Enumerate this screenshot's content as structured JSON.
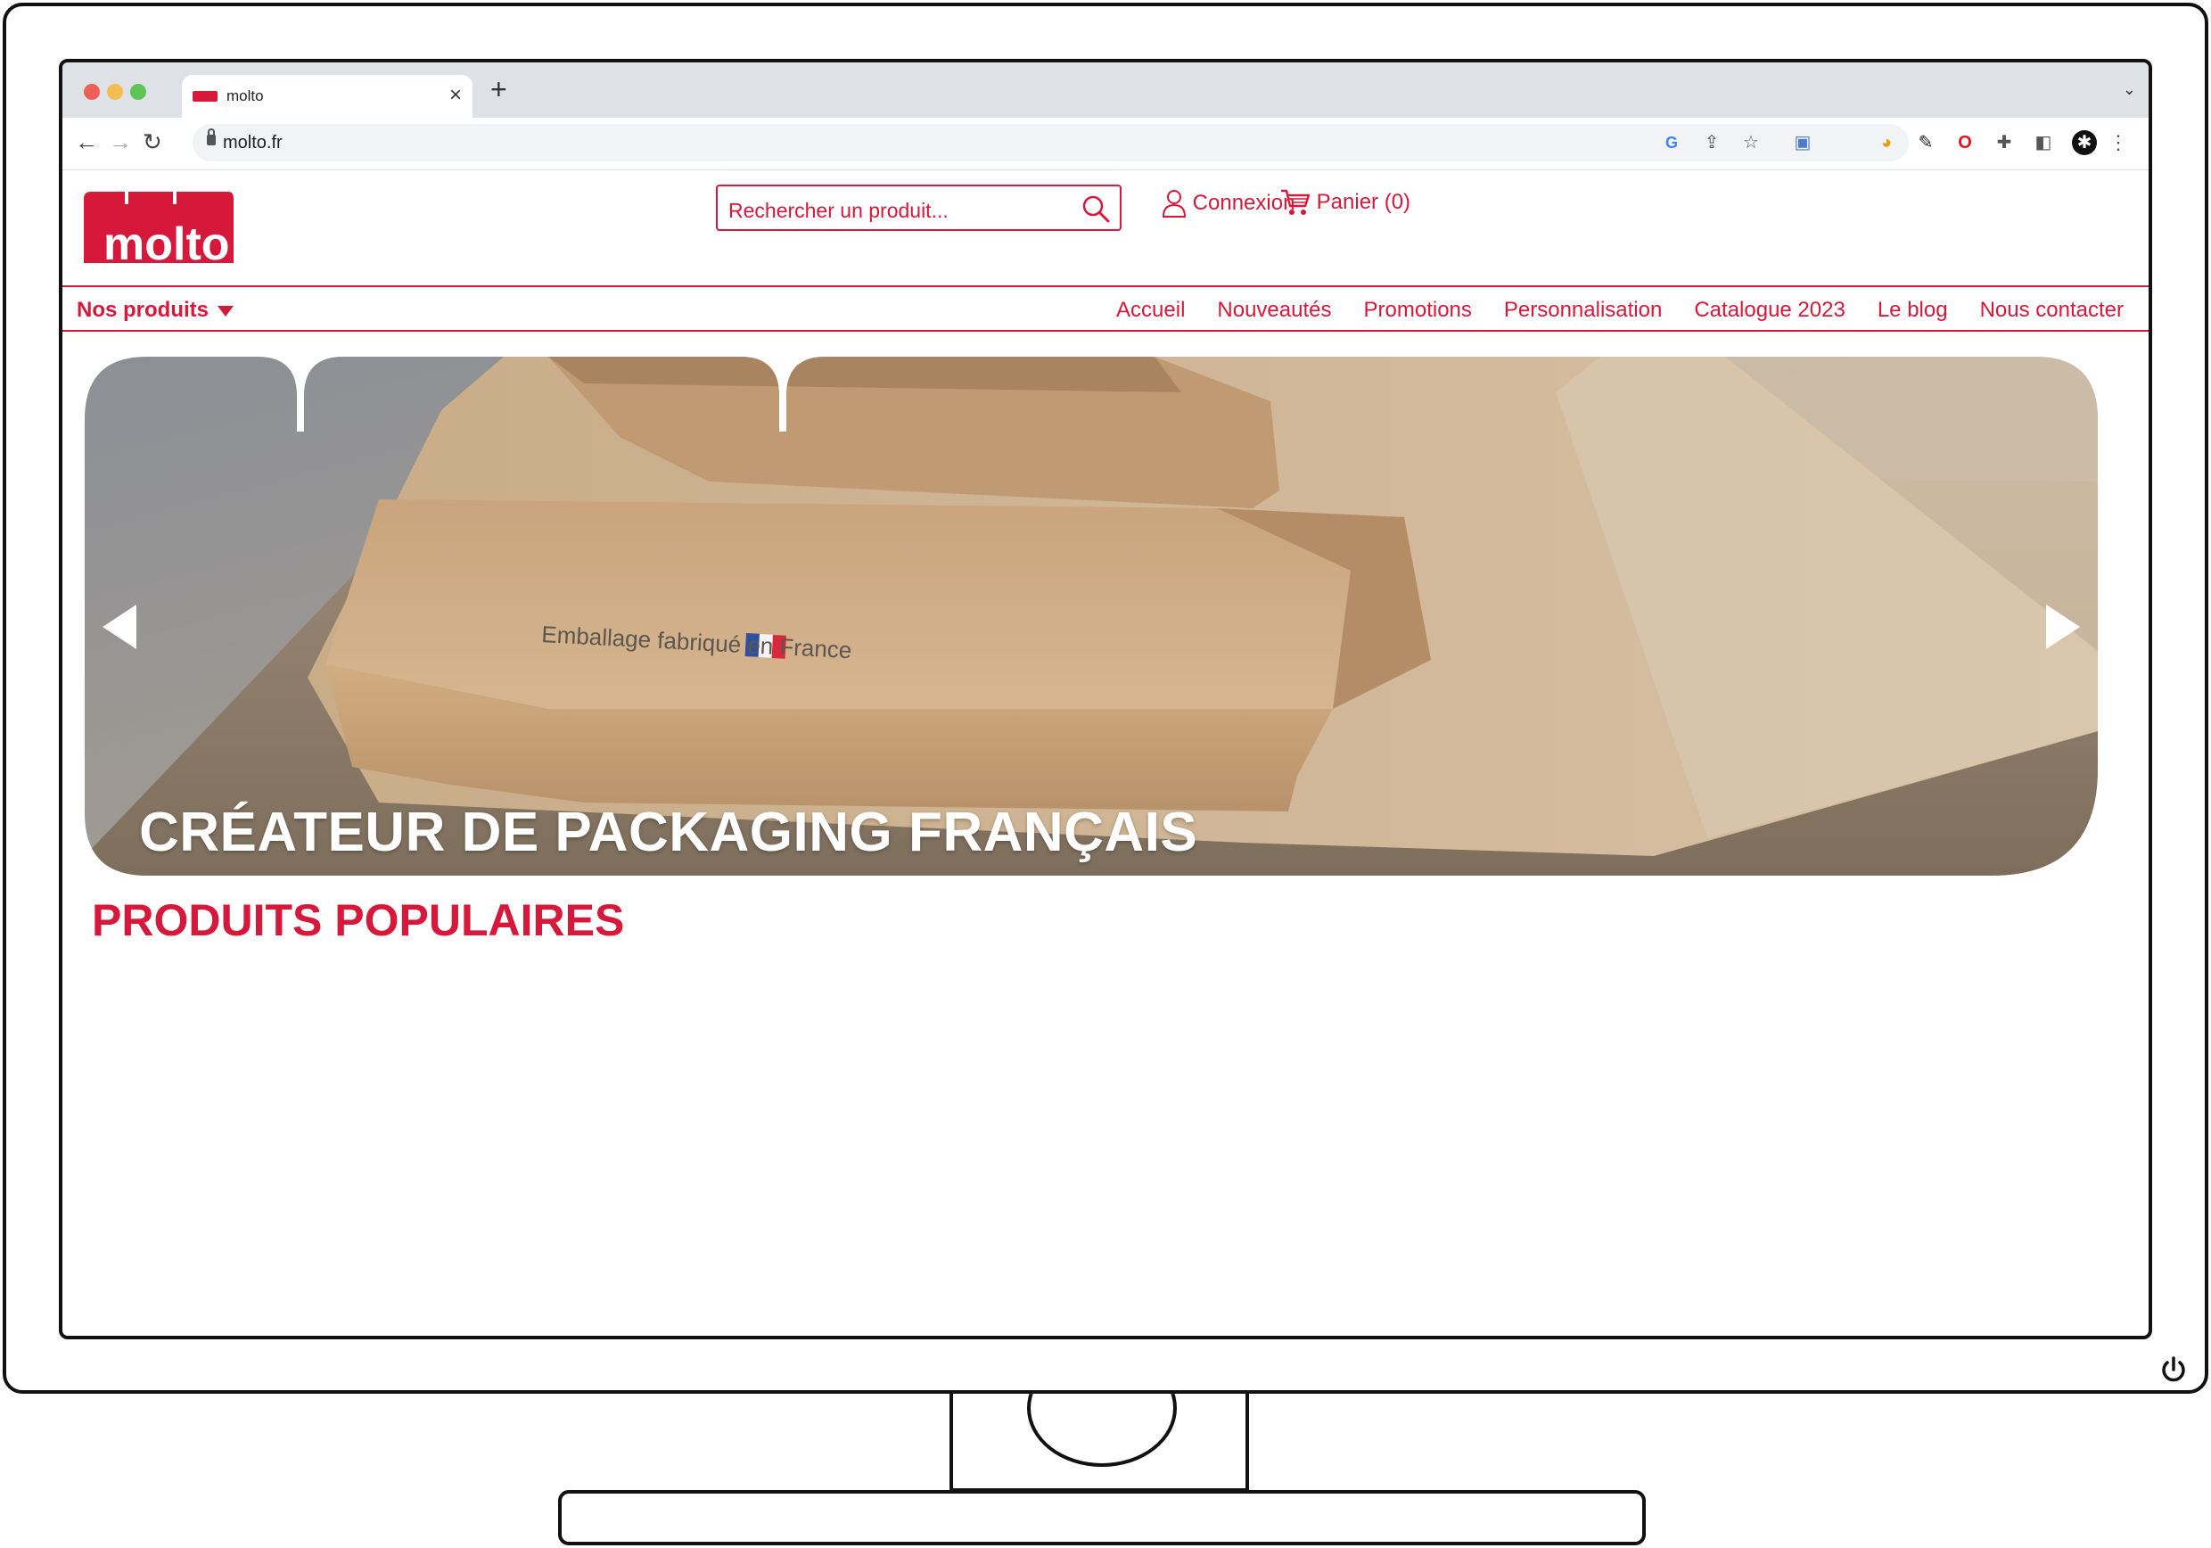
{
  "browser": {
    "tab_title": "molto",
    "tab_close": "×",
    "new_tab": "+",
    "tab_menu": "⌄",
    "url": "molto.fr",
    "back": "←",
    "forward": "→",
    "reload": "↻"
  },
  "site": {
    "logo_text": "molto",
    "search_placeholder": "Rechercher un produit...",
    "login_label": "Connexion",
    "cart_label": "Panier (0)",
    "products_menu": "Nos produits",
    "nav": [
      "Accueil",
      "Nouveautés",
      "Promotions",
      "Personnalisation",
      "Catalogue 2023",
      "Le blog",
      "Nous contacter"
    ],
    "hero_title": "CRÉATEUR DE PACKAGING FRANÇAIS",
    "box_print": "Emballage fabriqué en France",
    "section_title": "PRODUITS POPULAIRES"
  },
  "colors": {
    "brand": "#d6183a",
    "chrome": "#dee1e6"
  }
}
